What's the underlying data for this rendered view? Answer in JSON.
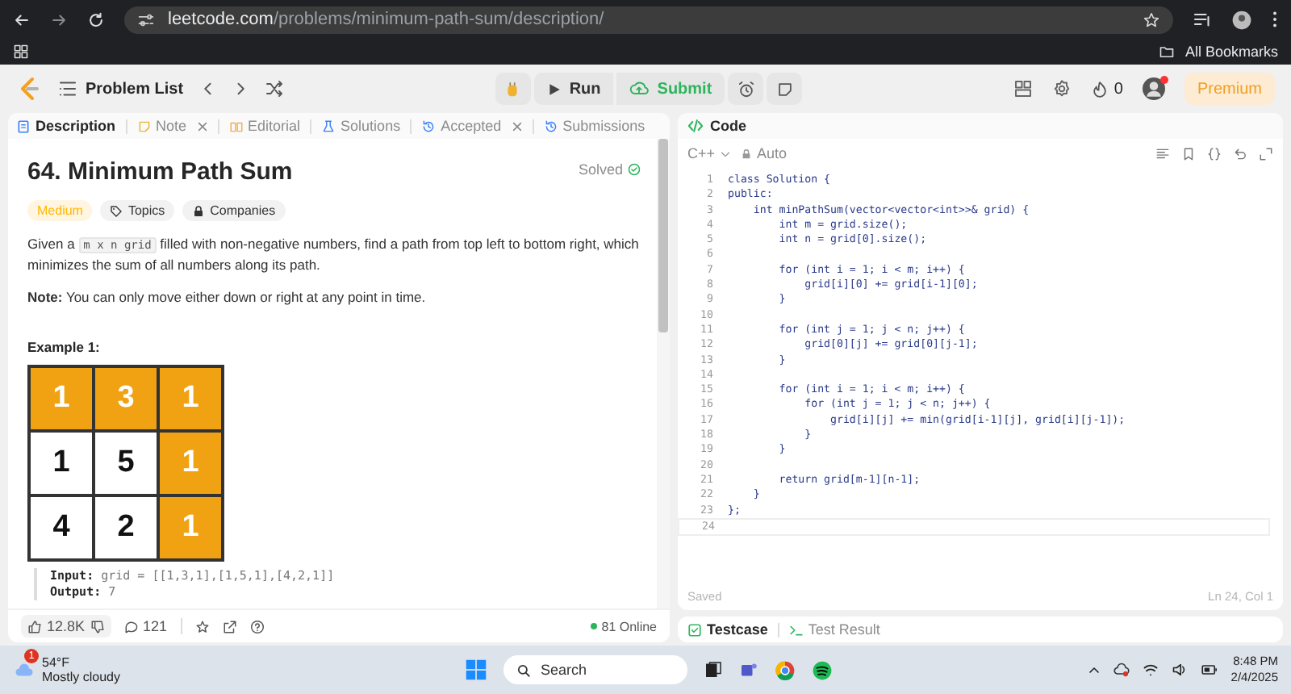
{
  "browser": {
    "url_host": "leetcode.com",
    "url_path": "/problems/minimum-path-sum/description/",
    "bookmarks_label": "All Bookmarks"
  },
  "header": {
    "problem_list": "Problem List",
    "run": "Run",
    "submit": "Submit",
    "streak": "0",
    "premium": "Premium"
  },
  "problem_tabs": [
    {
      "label": "Description",
      "selected": true,
      "closable": false,
      "kind": "description"
    },
    {
      "label": "Note",
      "selected": false,
      "closable": true,
      "kind": "note"
    },
    {
      "label": "Editorial",
      "selected": false,
      "closable": false,
      "kind": "editorial"
    },
    {
      "label": "Solutions",
      "selected": false,
      "closable": false,
      "kind": "solutions"
    },
    {
      "label": "Accepted",
      "selected": false,
      "closable": true,
      "kind": "history"
    },
    {
      "label": "Submissions",
      "selected": false,
      "closable": false,
      "kind": "history"
    }
  ],
  "problem": {
    "title": "64. Minimum Path Sum",
    "status": "Solved",
    "difficulty": "Medium",
    "tags": [
      {
        "label": "Topics",
        "kind": "tag"
      },
      {
        "label": "Companies",
        "kind": "lock"
      }
    ],
    "statement": [
      {
        "kind": "text",
        "text": "Given a "
      },
      {
        "kind": "code",
        "text": "m x n grid"
      },
      {
        "kind": "text",
        "text": " filled with non-negative numbers, find a path from top left to bottom right, which minimizes the sum of all numbers along its path."
      }
    ],
    "note": "**Note:** You can only move either down or right at any point in time.",
    "example_title": "Example 1:",
    "grid": [
      [
        {
          "value": "1",
          "on_path": true
        },
        {
          "value": "3",
          "on_path": true
        },
        {
          "value": "1",
          "on_path": true
        }
      ],
      [
        {
          "value": "1",
          "on_path": false
        },
        {
          "value": "5",
          "on_path": false
        },
        {
          "value": "1",
          "on_path": true
        }
      ],
      [
        {
          "value": "4",
          "on_path": false
        },
        {
          "value": "2",
          "on_path": false
        },
        {
          "value": "1",
          "on_path": true
        }
      ]
    ],
    "input_label": "Input:",
    "input_value": "grid = [[1,3,1],[1,5,1],[4,2,1]]",
    "output_label": "Output:",
    "output_value": "7"
  },
  "footer": {
    "likes": "12.8K",
    "comments": "121",
    "online": "81 Online"
  },
  "code_panel": {
    "title": "Code",
    "language": "C++",
    "mode": "Auto",
    "status": "Saved",
    "cursor": "Ln 24, Col 1",
    "lines": [
      {
        "number": "1",
        "text": "class Solution {"
      },
      {
        "number": "2",
        "text": "public:"
      },
      {
        "number": "3",
        "text": "    int minPathSum(vector<vector<int>>& grid) {"
      },
      {
        "number": "4",
        "text": "        int m = grid.size();"
      },
      {
        "number": "5",
        "text": "        int n = grid[0].size();"
      },
      {
        "number": "6"
      },
      {
        "number": "7",
        "text": "        for (int i = 1; i < m; i++) {"
      },
      {
        "number": "8",
        "text": "            grid[i][0] += grid[i-1][0];"
      },
      {
        "number": "9",
        "text": "        }"
      },
      {
        "number": "10"
      },
      {
        "number": "11",
        "text": "        for (int j = 1; j < n; j++) {"
      },
      {
        "number": "12",
        "text": "            grid[0][j] += grid[0][j-1];"
      },
      {
        "number": "13",
        "text": "        }"
      },
      {
        "number": "14"
      },
      {
        "number": "15",
        "text": "        for (int i = 1; i < m; i++) {"
      },
      {
        "number": "16",
        "text": "            for (int j = 1; j < n; j++) {"
      },
      {
        "number": "17",
        "text": "                grid[i][j] += min(grid[i-1][j], grid[i][j-1]);"
      },
      {
        "number": "18",
        "text": "            }"
      },
      {
        "number": "19",
        "text": "        }"
      },
      {
        "number": "20"
      },
      {
        "number": "21",
        "text": "        return grid[m-1][n-1];"
      },
      {
        "number": "22",
        "text": "    }"
      },
      {
        "number": "23",
        "text": "};"
      },
      {
        "number": "24",
        "current": true
      }
    ]
  },
  "bottom_tabs": [
    {
      "label": "Testcase",
      "selected": true
    },
    {
      "label": "Test Result",
      "selected": false
    }
  ],
  "taskbar": {
    "temperature": "54°F",
    "weather": "Mostly cloudy",
    "alert_count": "1",
    "search": "Search",
    "time": "8:48 PM",
    "date": "2/4/2025"
  }
}
